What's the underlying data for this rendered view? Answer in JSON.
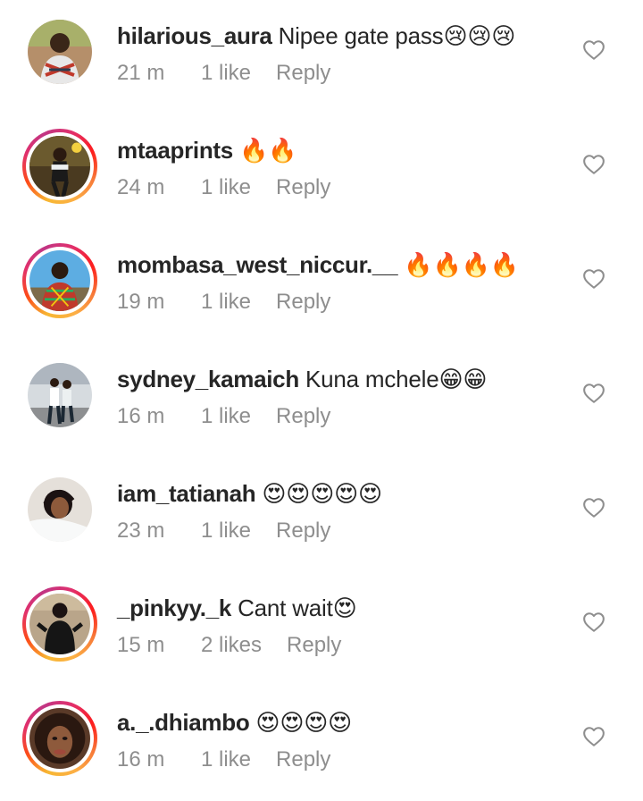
{
  "comments": [
    {
      "username": "hilarious_aura",
      "text": " Nipee gate pass😢😢😢",
      "time": "21 m",
      "likes": "1 like",
      "reply": "Reply",
      "story_ring": false
    },
    {
      "username": "mtaaprints",
      "text": " 🔥🔥",
      "time": "24 m",
      "likes": "1 like",
      "reply": "Reply",
      "story_ring": true
    },
    {
      "username": "mombasa_west_niccur.__",
      "text": " 🔥🔥🔥🔥",
      "time": "19 m",
      "likes": "1 like",
      "reply": "Reply",
      "story_ring": true
    },
    {
      "username": "sydney_kamaich",
      "text": " Kuna mchele😁😁",
      "time": "16 m",
      "likes": "1 like",
      "reply": "Reply",
      "story_ring": false
    },
    {
      "username": "iam_tatianah",
      "text": " 😍😍😍😍😍",
      "time": "23 m",
      "likes": "1 like",
      "reply": "Reply",
      "story_ring": false
    },
    {
      "username": "_pinkyy._k",
      "text": " Cant wait😍",
      "time": "15 m",
      "likes": "2 likes",
      "reply": "Reply",
      "story_ring": true
    },
    {
      "username": "a._.dhiambo",
      "text": " 😍😍😍😍",
      "time": "16 m",
      "likes": "1 like",
      "reply": "Reply",
      "story_ring": true
    }
  ],
  "colors": {
    "text_primary": "#262626",
    "text_secondary": "#8e8e8e",
    "background": "#ffffff",
    "heart_outline": "#8e8e8e"
  },
  "icons": {
    "like": "heart-outline-icon"
  }
}
